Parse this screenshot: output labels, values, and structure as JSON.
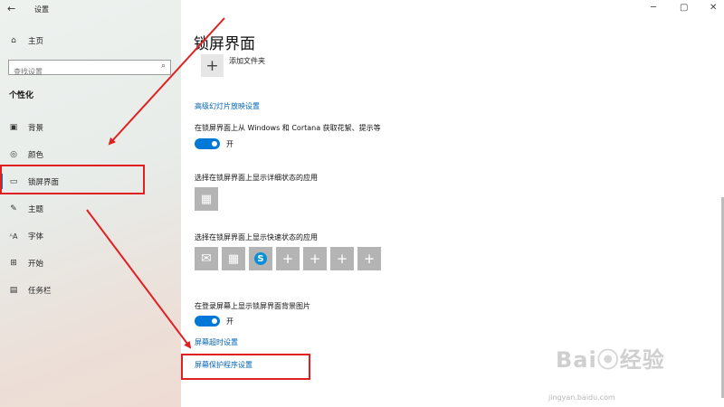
{
  "window": {
    "title": "设置",
    "back_glyph": "←",
    "minimize_glyph": "─",
    "maximize_glyph": "▢",
    "close_glyph": "✕"
  },
  "sidebar": {
    "home_label": "主页",
    "search_placeholder": "查找设置",
    "section_title": "个性化",
    "items": [
      {
        "label": "背景",
        "icon": "image-icon"
      },
      {
        "label": "颜色",
        "icon": "palette-icon"
      },
      {
        "label": "锁屏界面",
        "icon": "lockscreen-icon",
        "selected": true
      },
      {
        "label": "主题",
        "icon": "brush-icon"
      },
      {
        "label": "字体",
        "icon": "font-icon"
      },
      {
        "label": "开始",
        "icon": "start-icon"
      },
      {
        "label": "任务栏",
        "icon": "taskbar-icon"
      }
    ]
  },
  "main": {
    "page_title": "锁屏界面",
    "add_folder_label": "添加文件夹",
    "slideshow_link": "高级幻灯片放映设置",
    "fun_facts_label": "在锁屏界面上从 Windows 和 Cortana 获取花絮、提示等",
    "fun_facts_state": "开",
    "detailed_status_label": "选择在锁屏界面上显示详细状态的应用",
    "quick_status_label": "选择在锁屏界面上显示快速状态的应用",
    "quick_status_apps": [
      {
        "icon": "mail-icon"
      },
      {
        "icon": "calendar-icon"
      },
      {
        "icon": "skype-icon"
      },
      {
        "icon": "plus-icon"
      },
      {
        "icon": "plus-icon"
      },
      {
        "icon": "plus-icon"
      },
      {
        "icon": "plus-icon"
      }
    ],
    "signin_background_label": "在登录屏幕上显示锁屏界面背景图片",
    "signin_background_state": "开",
    "timeout_link": "屏幕超时设置",
    "screensaver_link": "屏幕保护程序设置"
  },
  "watermark": {
    "logo_text": "Baidu 经验",
    "url": "jingyan.baidu.com"
  },
  "colors": {
    "accent": "#0078d7",
    "link": "#0063b1",
    "annotation_red": "#e02020",
    "tile_gray": "#b4b4b4"
  }
}
